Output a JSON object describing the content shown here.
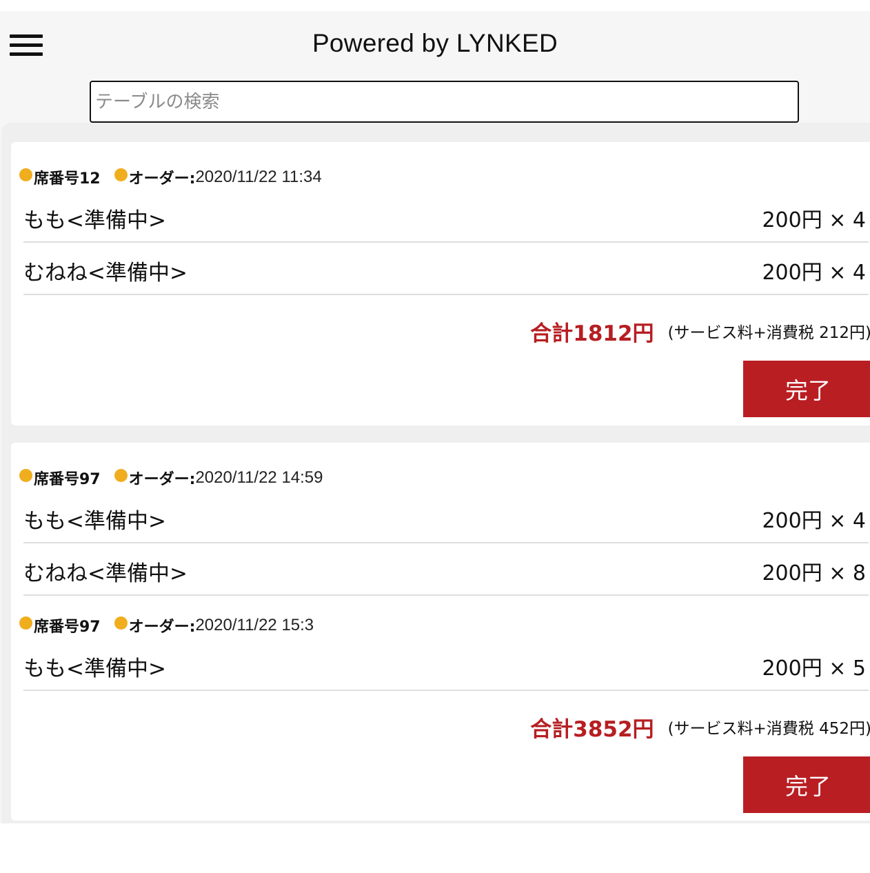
{
  "header": {
    "title": "Powered by LYNKED",
    "search_placeholder": "テーブルの検索"
  },
  "cards": [
    {
      "orders": [
        {
          "seat": "席番号12",
          "order_label": "オーダー:",
          "order_time": "2020/11/22 11:34",
          "items": [
            {
              "name": "もも<準備中>",
              "price": "200円 × 4"
            },
            {
              "name": "むねね<準備中>",
              "price": "200円 × 4"
            }
          ]
        }
      ],
      "total": "合計1812円",
      "fee": "(サービス料+消費税 212円)",
      "done_label": "完了"
    },
    {
      "orders": [
        {
          "seat": "席番号97",
          "order_label": "オーダー:",
          "order_time": "2020/11/22 14:59",
          "items": [
            {
              "name": "もも<準備中>",
              "price": "200円 × 4"
            },
            {
              "name": "むねね<準備中>",
              "price": "200円 × 8"
            }
          ]
        },
        {
          "seat": "席番号97",
          "order_label": "オーダー:",
          "order_time": "2020/11/22 15:3",
          "items": [
            {
              "name": "もも<準備中>",
              "price": "200円 × 5"
            }
          ]
        }
      ],
      "total": "合計3852円",
      "fee": "(サービス料+消費税 452円)",
      "done_label": "完了"
    }
  ],
  "colors": {
    "accent_red": "#b91e23",
    "status_dot": "#f0ae1e"
  }
}
